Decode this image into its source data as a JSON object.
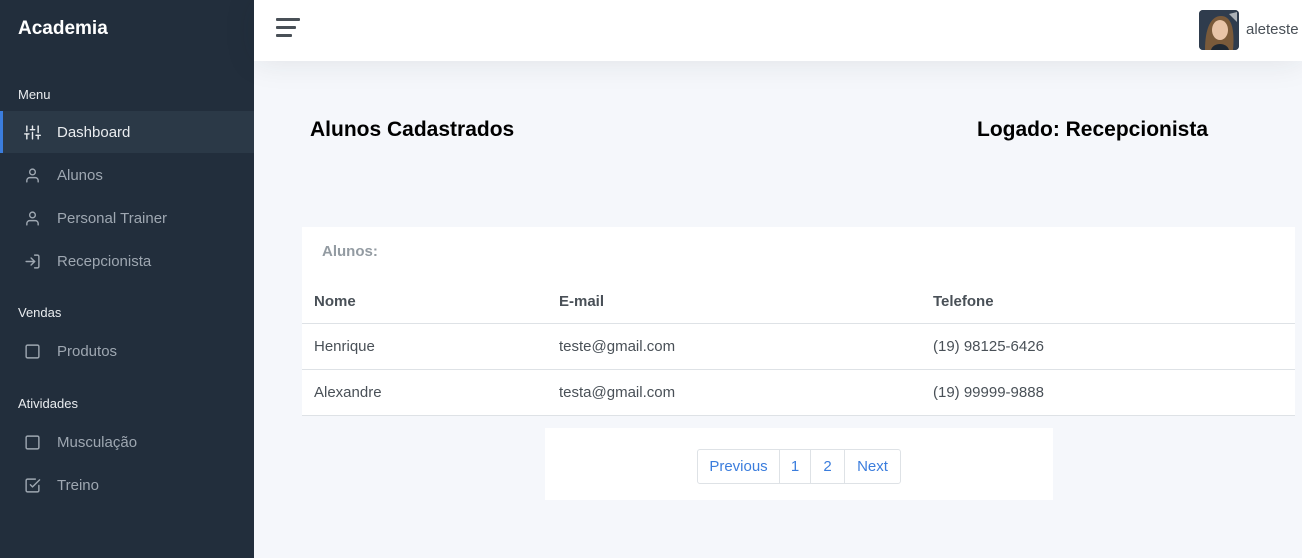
{
  "sidebar": {
    "brand": "Academia",
    "sections": {
      "menu": "Menu",
      "vendas": "Vendas",
      "atividades": "Atividades"
    },
    "items": {
      "dashboard": {
        "label": "Dashboard",
        "icon": "sliders-icon"
      },
      "alunos": {
        "label": "Alunos",
        "icon": "user-icon"
      },
      "personal": {
        "label": "Personal Trainer",
        "icon": "user-icon"
      },
      "recepcionista": {
        "label": "Recepcionista",
        "icon": "log-in-icon"
      },
      "produtos": {
        "label": "Produtos",
        "icon": "square-icon"
      },
      "musculacao": {
        "label": "Musculação",
        "icon": "square-icon"
      },
      "treino": {
        "label": "Treino",
        "icon": "check-square-icon"
      }
    },
    "active": "dashboard"
  },
  "topbar": {
    "username": "aleteste"
  },
  "page": {
    "title": "Alunos Cadastrados",
    "logged": "Logado: Recepcionista"
  },
  "table": {
    "label": "Alunos:",
    "headers": {
      "nome": "Nome",
      "email": "E-mail",
      "telefone": "Telefone"
    },
    "rows": [
      {
        "nome": "Henrique",
        "email": "teste@gmail.com",
        "telefone": "(19) 98125-6426"
      },
      {
        "nome": "Alexandre",
        "email": "testa@gmail.com",
        "telefone": "(19) 99999-9888"
      }
    ]
  },
  "pagination": {
    "previous": "Previous",
    "pages": [
      "1",
      "2"
    ],
    "next": "Next"
  },
  "colors": {
    "sidebar_bg": "#222e3c",
    "accent": "#3b7ddd",
    "content_bg": "#f5f7fb"
  }
}
